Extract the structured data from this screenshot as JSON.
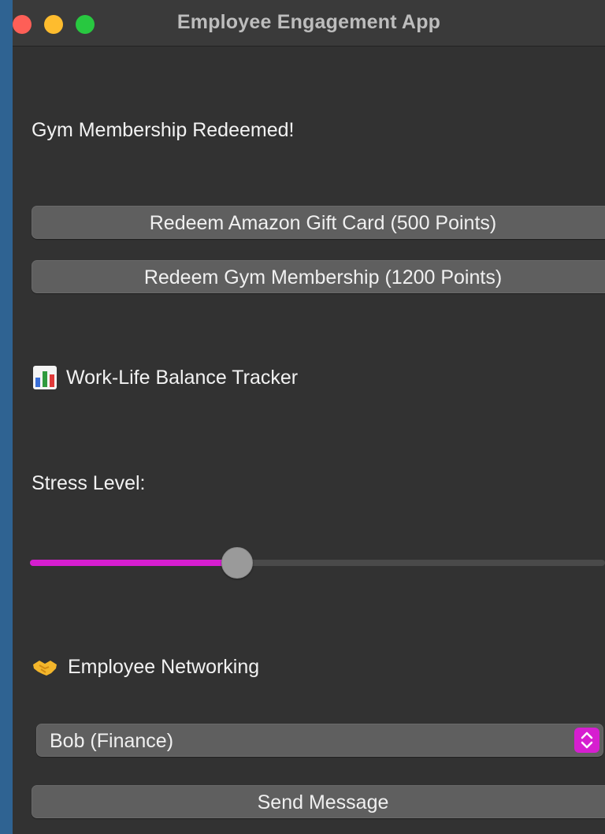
{
  "window": {
    "title": "Employee Engagement App"
  },
  "status": {
    "message": "Gym Membership Redeemed!"
  },
  "rewards": {
    "amazon_button": "Redeem Amazon Gift Card (500 Points)",
    "gym_button": "Redeem Gym Membership (1200 Points)"
  },
  "tracker": {
    "icon": "bar-chart-icon",
    "title": "Work-Life Balance Tracker",
    "stress_label": "Stress Level:",
    "stress_fraction": 0.36
  },
  "networking": {
    "icon": "handshake-icon",
    "title": "Employee Networking",
    "selected_employee": "Bob (Finance)",
    "send_button": "Send Message"
  },
  "colors": {
    "accent": "#d61ed0",
    "close": "#fe5f57",
    "minimize": "#febc2e",
    "maximize": "#28c840"
  }
}
